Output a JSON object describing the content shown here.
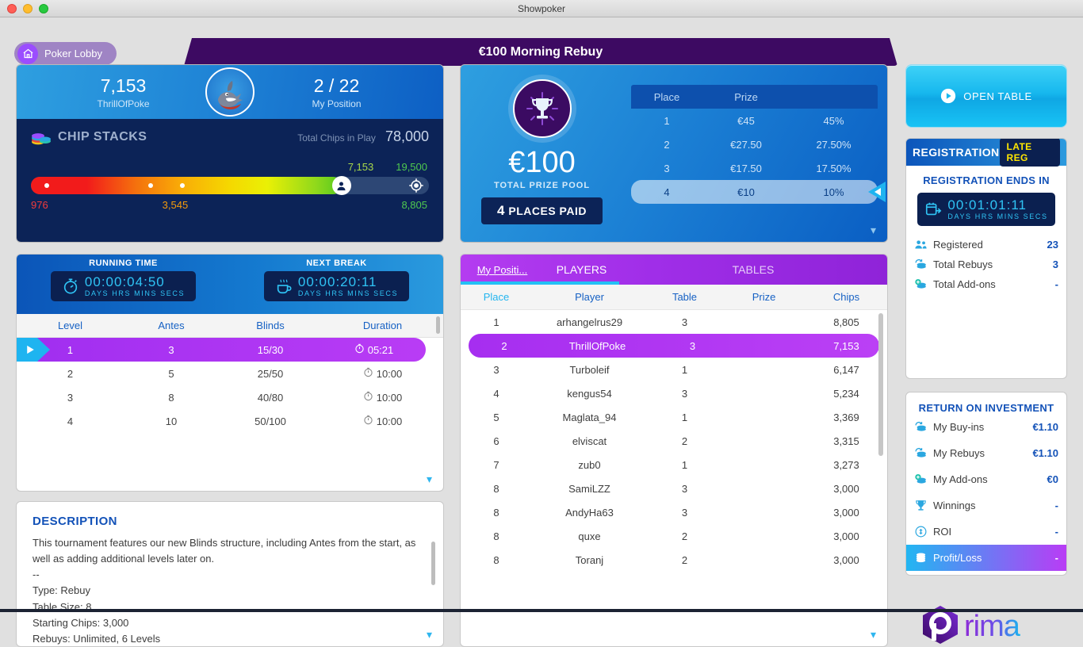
{
  "window": {
    "title": "Showpoker"
  },
  "nav": {
    "lobby_label": "Poker Lobby",
    "banner_title": "€100 Morning Rebuy"
  },
  "player_panel": {
    "chips": "7,153",
    "username": "ThrillOfPoke",
    "position": "2 / 22",
    "position_label": "My Position",
    "chip_stacks_title": "CHIP STACKS",
    "total_chips_label": "Total Chips in Play",
    "total_chips_value": "78,000",
    "bar_my_chips": "7,153",
    "bar_max_scale": "19,500",
    "bar_min": "976",
    "bar_mid": "3,545",
    "bar_leader": "8,805"
  },
  "prize_panel": {
    "amount": "€100",
    "subtitle": "TOTAL PRIZE POOL",
    "places_paid_count": "4",
    "places_paid_label": "PLACES PAID",
    "headers": {
      "place": "Place",
      "prize": "Prize",
      "pct": ""
    },
    "rows": [
      {
        "place": "1",
        "prize": "€45",
        "pct": "45%",
        "selected": false
      },
      {
        "place": "2",
        "prize": "€27.50",
        "pct": "27.50%",
        "selected": false
      },
      {
        "place": "3",
        "prize": "€17.50",
        "pct": "17.50%",
        "selected": false
      },
      {
        "place": "4",
        "prize": "€10",
        "pct": "10%",
        "selected": true
      }
    ]
  },
  "levels_panel": {
    "running_time_label": "RUNNING TIME",
    "running_time_digits": "00:00:04:50",
    "next_break_label": "NEXT BREAK",
    "next_break_digits": "00:00:20:11",
    "clock_units": "DAYS  HRS  MINS  SECS",
    "headers": {
      "level": "Level",
      "antes": "Antes",
      "blinds": "Blinds",
      "duration": "Duration"
    },
    "rows": [
      {
        "level": "1",
        "antes": "3",
        "blinds": "15/30",
        "duration": "05:21",
        "active": true
      },
      {
        "level": "2",
        "antes": "5",
        "blinds": "25/50",
        "duration": "10:00",
        "active": false
      },
      {
        "level": "3",
        "antes": "8",
        "blinds": "40/80",
        "duration": "10:00",
        "active": false
      },
      {
        "level": "4",
        "antes": "10",
        "blinds": "50/100",
        "duration": "10:00",
        "active": false
      }
    ]
  },
  "description_panel": {
    "title": "DESCRIPTION",
    "body": "This tournament features our new Blinds structure, including Antes from the start, as well as adding additional levels later on.\n--\nType: Rebuy\nTable Size: 8\nStarting Chips: 3,000\nRebuys: Unlimited, 6 Levels"
  },
  "players_panel": {
    "tabs": [
      {
        "label": "My Positi...",
        "active": true
      },
      {
        "label": "PLAYERS",
        "active": true
      },
      {
        "label": "TABLES",
        "active": false
      }
    ],
    "headers": {
      "place": "Place",
      "player": "Player",
      "table": "Table",
      "prize": "Prize",
      "chips": "Chips"
    },
    "rows": [
      {
        "place": "1",
        "player": "arhangelrus29",
        "table": "3",
        "prize": "",
        "chips": "8,805",
        "me": false
      },
      {
        "place": "2",
        "player": "ThrillOfPoke",
        "table": "3",
        "prize": "",
        "chips": "7,153",
        "me": true
      },
      {
        "place": "3",
        "player": "Turboleif",
        "table": "1",
        "prize": "",
        "chips": "6,147",
        "me": false
      },
      {
        "place": "4",
        "player": "kengus54",
        "table": "3",
        "prize": "",
        "chips": "5,234",
        "me": false
      },
      {
        "place": "5",
        "player": "Maglata_94",
        "table": "1",
        "prize": "",
        "chips": "3,369",
        "me": false
      },
      {
        "place": "6",
        "player": "elviscat",
        "table": "2",
        "prize": "",
        "chips": "3,315",
        "me": false
      },
      {
        "place": "7",
        "player": "zub0",
        "table": "1",
        "prize": "",
        "chips": "3,273",
        "me": false
      },
      {
        "place": "8",
        "player": "SamiLZZ",
        "table": "3",
        "prize": "",
        "chips": "3,000",
        "me": false
      },
      {
        "place": "8",
        "player": "AndyHa63",
        "table": "3",
        "prize": "",
        "chips": "3,000",
        "me": false
      },
      {
        "place": "8",
        "player": "quxe",
        "table": "2",
        "prize": "",
        "chips": "3,000",
        "me": false
      },
      {
        "place": "8",
        "player": "Toranj",
        "table": "2",
        "prize": "",
        "chips": "3,000",
        "me": false
      }
    ]
  },
  "sidebar": {
    "open_table_label": "OPEN TABLE",
    "registration": {
      "title": "REGISTRATION",
      "late_badge": "LATE REG",
      "ends_in_label": "REGISTRATION ENDS IN",
      "clock_digits": "00:01:01:11",
      "clock_units": "DAYS  HRS  MINS  SECS",
      "rows": [
        {
          "label": "Registered",
          "value": "23",
          "icon": "people-icon"
        },
        {
          "label": "Total Rebuys",
          "value": "3",
          "icon": "rebuy-chips-icon"
        },
        {
          "label": "Total Add-ons",
          "value": "-",
          "icon": "addon-chips-icon"
        }
      ]
    },
    "roi": {
      "title": "RETURN ON INVESTMENT",
      "rows": [
        {
          "label": "My Buy-ins",
          "value": "€1.10",
          "icon": "buyin-chips-icon",
          "highlight": false
        },
        {
          "label": "My Rebuys",
          "value": "€1.10",
          "icon": "rebuy-chips-icon",
          "highlight": false
        },
        {
          "label": "My Add-ons",
          "value": "€0",
          "icon": "addon-chips-icon",
          "highlight": false
        },
        {
          "label": "Winnings",
          "value": "-",
          "icon": "trophy-icon",
          "highlight": false
        },
        {
          "label": "ROI",
          "value": "-",
          "icon": "roi-icon",
          "highlight": false
        },
        {
          "label": "Profit/Loss",
          "value": "-",
          "icon": "profitloss-icon",
          "highlight": true
        }
      ]
    },
    "logo_text": "prima"
  },
  "colors": {
    "brand_purple": "#3d0a62",
    "accent_cyan": "#23c0f5",
    "accent_magenta": "#b93cf5",
    "blue_dark": "#0c2357",
    "link_blue": "#1352b8"
  }
}
